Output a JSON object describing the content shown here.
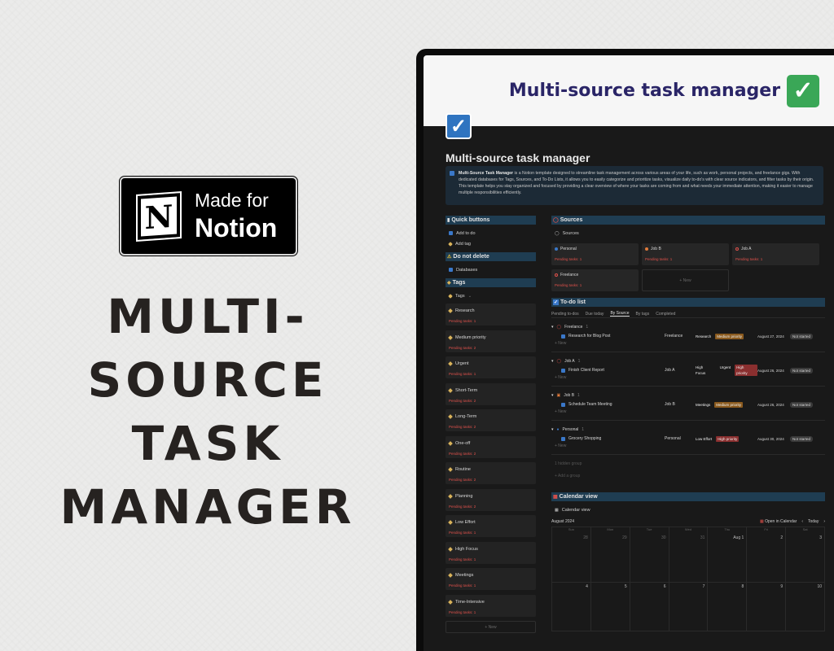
{
  "badge": {
    "line1": "Made for",
    "line2": "Notion",
    "logo_letter": "N"
  },
  "hero": {
    "line1": "MULTI-SOURCE",
    "line2": "TASK",
    "line3": "MANAGER"
  },
  "cover": {
    "title": "Multi-source task manager",
    "icon": "✓"
  },
  "page": {
    "icon": "✓",
    "title": "Multi-source task manager",
    "callout_bold": "Multi-Source Task Manager",
    "callout_text": " is a Notion template designed to streamline task management across various areas of your life, such as work, personal projects, and freelance gigs. With dedicated databases for Tags, Sources, and To-Do Lists, it allows you to easily categorize and prioritize tasks, visualize daily to-do's with clear source indicators, and filter tasks by their origin. This template helps you stay organized and focused by providing a clear overview of where your tasks are coming from and what needs your immediate attention, making it easier to manage multiple responsibilities efficiently."
  },
  "quick_buttons": {
    "heading": "Quick buttons",
    "items": [
      "Add to do",
      "Add tag"
    ]
  },
  "do_not_delete": {
    "heading": "Do not delete",
    "item": "Databases"
  },
  "tags": {
    "heading": "Tags",
    "view": "Tags",
    "items": [
      {
        "name": "Research",
        "pending": "Pending tasks: 1"
      },
      {
        "name": "Medium priority",
        "pending": "Pending tasks: 2"
      },
      {
        "name": "Urgent",
        "pending": "Pending tasks: 1"
      },
      {
        "name": "Short-Term",
        "pending": "Pending tasks: 2"
      },
      {
        "name": "Long-Term",
        "pending": "Pending tasks: 2"
      },
      {
        "name": "One-off",
        "pending": "Pending tasks: 2"
      },
      {
        "name": "Routine",
        "pending": "Pending tasks: 2"
      },
      {
        "name": "Planning",
        "pending": "Pending tasks: 2"
      },
      {
        "name": "Low Effort",
        "pending": "Pending tasks: 1"
      },
      {
        "name": "High Focus",
        "pending": "Pending tasks: 1"
      },
      {
        "name": "Meetings",
        "pending": "Pending tasks: 1"
      },
      {
        "name": "Time-Intensive",
        "pending": "Pending tasks: 1"
      }
    ],
    "new_label": "+ New"
  },
  "sources": {
    "heading": "Sources",
    "view": "Sources",
    "items": [
      {
        "name": "Personal",
        "pending": "Pending tasks: 1",
        "color": "#3a78c9"
      },
      {
        "name": "Job B",
        "pending": "Pending tasks: 1",
        "color": "#e0514b"
      },
      {
        "name": "Job A",
        "pending": "Pending tasks: 1",
        "color": "#e0514b"
      },
      {
        "name": "Freelance",
        "pending": "Pending tasks: 1",
        "color": "#e0514b"
      }
    ],
    "new_label": "+ New"
  },
  "todo": {
    "heading": "To-do list",
    "views": [
      "Pending to-dos",
      "Due today",
      "By Source",
      "By tags",
      "Completed"
    ],
    "active_view": "By Source",
    "groups": [
      {
        "name": "Freelance",
        "count": "1",
        "task": "Research for Blog Post",
        "source": "Freelance",
        "tags": [
          {
            "label": "Research",
            "color": ""
          },
          {
            "label": "Medium priority",
            "color": "#8a5a1e"
          }
        ],
        "date": "August 27, 2024",
        "status": "Not started"
      },
      {
        "name": "Job A",
        "count": "1",
        "task": "Finish Client Report",
        "source": "Job A",
        "tags": [
          {
            "label": "High Focus",
            "color": ""
          },
          {
            "label": "Urgent",
            "color": ""
          },
          {
            "label": "High priority",
            "color": "#8a2f2f"
          }
        ],
        "date": "August 26, 2024",
        "status": "Not started"
      },
      {
        "name": "Job B",
        "count": "1",
        "task": "Schedule Team Meeting",
        "source": "Job B",
        "tags": [
          {
            "label": "Meetings",
            "color": ""
          },
          {
            "label": "Medium priority",
            "color": "#8a5a1e"
          }
        ],
        "date": "August 26, 2024",
        "status": "Not started"
      },
      {
        "name": "Personal",
        "count": "1",
        "task": "Grocery Shopping",
        "source": "Personal",
        "tags": [
          {
            "label": "Low Effort",
            "color": ""
          },
          {
            "label": "High priority",
            "color": "#8a2f2f"
          }
        ],
        "date": "August 30, 2024",
        "status": "Not started"
      }
    ],
    "new_row": "+ New",
    "hidden_group": "1 hidden group",
    "add_group": "+ Add a group"
  },
  "calendar": {
    "heading": "Calendar view",
    "view": "Calendar view",
    "month": "August 2024",
    "open_label": "Open in Calendar",
    "today_label": "Today",
    "dows": [
      "Sun",
      "Mon",
      "Tue",
      "Wed",
      "Thu",
      "Fri",
      "Sat"
    ],
    "row1": [
      "28",
      "29",
      "30",
      "31",
      "Aug 1",
      "2",
      "3"
    ],
    "row2": [
      "4",
      "5",
      "6",
      "7",
      "8",
      "9",
      "10"
    ]
  },
  "colors": {
    "accent": "#3a78c9",
    "section_header": "#1f3d52",
    "pending_red": "#e0514b",
    "check_green": "#3aa757"
  }
}
